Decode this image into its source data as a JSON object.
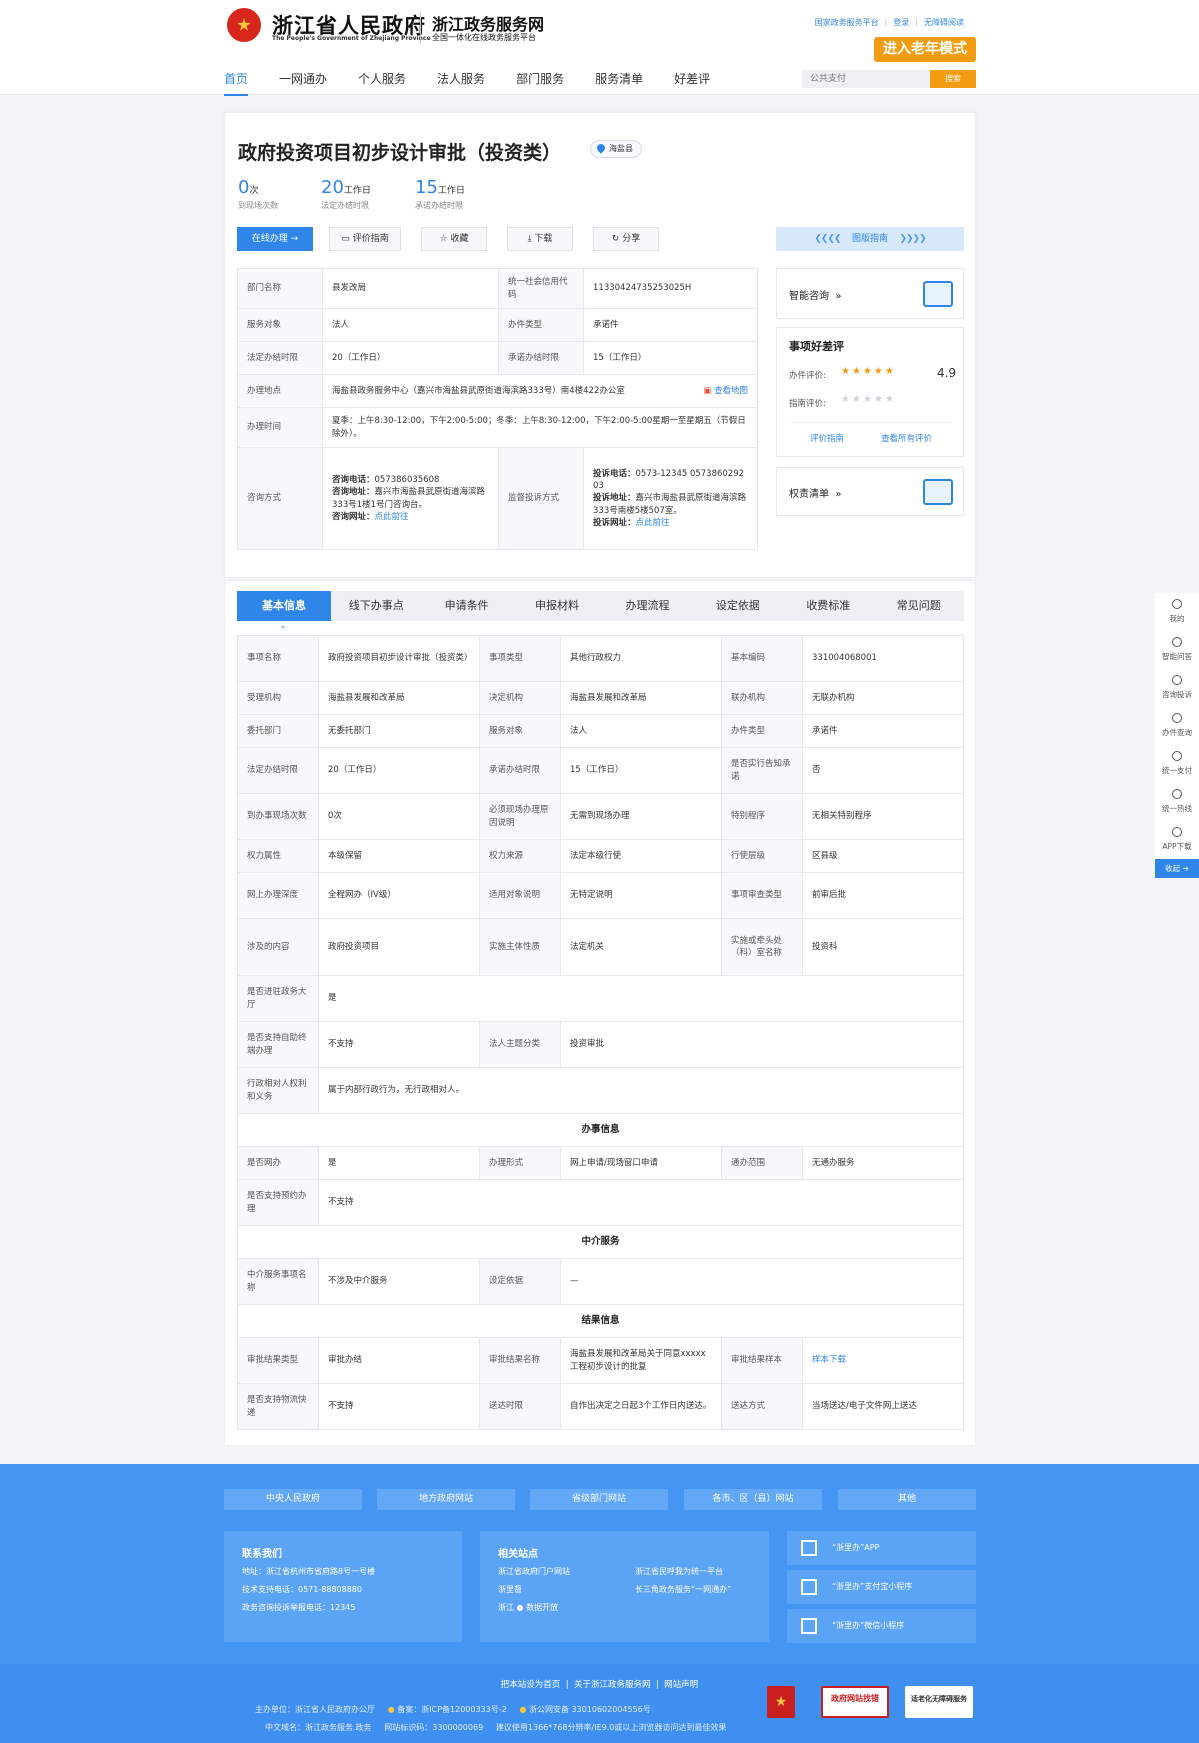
{
  "header": {
    "gov_title": "浙江省人民政府",
    "gov_en": "The People's Government of Zhejiang Province",
    "site_title": "浙江政务服务网",
    "site_sub": "全国一体化在线政务服务平台",
    "top_links": [
      "国家政务服务平台",
      "登录",
      "无障碍阅读"
    ],
    "elderly_mode": "进入老年模式",
    "nav": [
      "首页",
      "一网通办",
      "个人服务",
      "法人服务",
      "部门服务",
      "服务清单",
      "好差评"
    ],
    "search_placeholder": "公共支付",
    "search_btn": "搜索"
  },
  "item": {
    "title": "政府投资项目初步设计审批（投资类）",
    "area": "海盐县",
    "stats": [
      {
        "num": "0",
        "unit": "次",
        "label": "到现场次数"
      },
      {
        "num": "20",
        "unit": "工作日",
        "label": "法定办结时限"
      },
      {
        "num": "15",
        "unit": "工作日",
        "label": "承诺办结时限"
      }
    ],
    "buttons": [
      "在线办理",
      "评价指南",
      "收藏",
      "下载",
      "分享"
    ],
    "guide": "图版指南"
  },
  "info": {
    "dept_k": "部门名称",
    "dept_v": "县发改局",
    "code_k": "统一社会信用代码",
    "code_v": "11330424735253025H",
    "obj_k": "服务对象",
    "obj_v": "法人",
    "type_k": "办件类型",
    "type_v": "承诺件",
    "legal_k": "法定办结时限",
    "legal_v": "20（工作日）",
    "promise_k": "承诺办结时限",
    "promise_v": "15（工作日）",
    "addr_k": "办理地点",
    "addr_v": "海盐县政务服务中心（嘉兴市海盐县武原街道海滨路333号）南4楼422办公室",
    "map": "查看地图",
    "time_k": "办理时间",
    "time_v": "夏季：上午8:30-12:00，下午2:00-5:00；冬季：上午8:30-12:00，下午2:00-5:00星期一至星期五（节假日除外）。",
    "consult_k": "咨询方式",
    "c_tel_l": "咨询电话：",
    "c_tel": "057386035608",
    "c_addr_l": "咨询地址：",
    "c_addr": "嘉兴市海盐县武原街道海滨路333号1楼1号门咨询台。",
    "c_web_l": "咨询网址：",
    "c_web": "点此前往",
    "complain_k": "监督投诉方式",
    "p_tel_l": "投诉电话：",
    "p_tel": "0573-12345 057386029203",
    "p_addr_l": "投诉地址：",
    "p_addr": "嘉兴市海盐县武原街道海滨路333号南楼5楼507室。",
    "p_web_l": "投诉网址：",
    "p_web": "点此前往"
  },
  "right": {
    "smart": "智能咨询",
    "rating_title": "事项好差评",
    "r1": "办件评价:",
    "score": "4.9",
    "r2": "指南评价:",
    "link1": "评价指南",
    "link2": "查看所有评价",
    "power": "权责清单"
  },
  "tabs": [
    "基本信息",
    "线下办事点",
    "申请条件",
    "申报材料",
    "办理流程",
    "设定依据",
    "收费标准",
    "常见问题"
  ],
  "basic": {
    "r1": [
      "事项名称",
      "政府投资项目初步设计审批（投资类）",
      "事项类型",
      "其他行政权力",
      "基本编码",
      "331004068001"
    ],
    "r2": [
      "受理机构",
      "海盐县发展和改革局",
      "决定机构",
      "海盐县发展和改革局",
      "联办机构",
      "无联办机构"
    ],
    "r3": [
      "委托部门",
      "无委托部门",
      "服务对象",
      "法人",
      "办件类型",
      "承诺件"
    ],
    "r4": [
      "法定办结时限",
      "20（工作日）",
      "承诺办结时限",
      "15（工作日）",
      "是否实行告知承诺",
      "否"
    ],
    "r5": [
      "到办事现场次数",
      "0次",
      "必须现场办理原因说明",
      "无需到现场办理",
      "特别程序",
      "无相关特别程序"
    ],
    "r6": [
      "权力属性",
      "本级保留",
      "权力来源",
      "法定本级行使",
      "行使层级",
      "区县级"
    ],
    "r7": [
      "网上办理深度",
      "全程网办（IV级）",
      "适用对象说明",
      "无特定说明",
      "事项审查类型",
      "前审后批"
    ],
    "r8": [
      "涉及的内容",
      "政府投资项目",
      "实施主体性质",
      "法定机关",
      "实施或牵头处（科）室名称",
      "投资科"
    ],
    "r9": [
      "是否进驻政务大厅",
      "是"
    ],
    "r10": [
      "是否支持自助终端办理",
      "不支持",
      "法人主题分类",
      "投资审批"
    ],
    "r11": [
      "行政相对人权利和义务",
      "属于内部行政行为，无行政相对人。"
    ],
    "sec1": "办事信息",
    "r12": [
      "是否网办",
      "是",
      "办理形式",
      "网上申请/现场窗口申请",
      "通办范围",
      "无通办服务"
    ],
    "r13": [
      "是否支持预约办理",
      "不支持"
    ],
    "sec2": "中介服务",
    "r14": [
      "中介服务事项名称",
      "不涉及中介服务",
      "设定依据",
      "—"
    ],
    "sec3": "结果信息",
    "r15": [
      "审批结果类型",
      "审批办结",
      "审批结果名称",
      "海盐县发展和改革局关于同意xxxxx工程初步设计的批复",
      "审批结果样本",
      "样本下载"
    ],
    "r16": [
      "是否支持物流快递",
      "不支持",
      "送达时限",
      "自作出决定之日起3个工作日内送达。",
      "送达方式",
      "当场送达/电子文件网上送达"
    ]
  },
  "sidebar": [
    "我的",
    "智能问答",
    "咨询投诉",
    "办件查询",
    "统一支付",
    "统一热线",
    "APP下载",
    "收起"
  ],
  "footer": {
    "links": [
      "中央人民政府",
      "地方政府网站",
      "省级部门网站",
      "各市、区（县）网站",
      "其他"
    ],
    "contact_title": "联系我们",
    "contact": [
      "地址：浙江省杭州市省府路8号一号楼",
      "技术支持电话：0571-88808880",
      "政务咨询投诉举报电话：12345"
    ],
    "related_title": "相关站点",
    "related": [
      "浙江省政府门户网站",
      "浙江省民呼我为统一平台",
      "浙里督",
      "长三角政务服务“一网通办”",
      "浙江 ● 数据开放"
    ],
    "apps": [
      "“浙里办”APP",
      "“浙里办”支付宝小程序",
      "“浙里办”微信小程序"
    ],
    "bottom_links": [
      "把本站设为首页",
      "关于浙江政务服务网",
      "网站声明"
    ],
    "sponsor": "主办单位：浙江省人民政府办公厅",
    "icp": "备案：浙ICP备12000333号-2",
    "police": "浙公网安备 33010602004556号",
    "domain": "中文域名：浙江政务服务.政务",
    "code": "网站标识码：3300000069",
    "browser": "建议使用1366*768分辨率/IE9.0或以上浏览器访问达到最佳效果",
    "badge1": "政府网站找错",
    "badge2": "适老化无障碍服务"
  }
}
